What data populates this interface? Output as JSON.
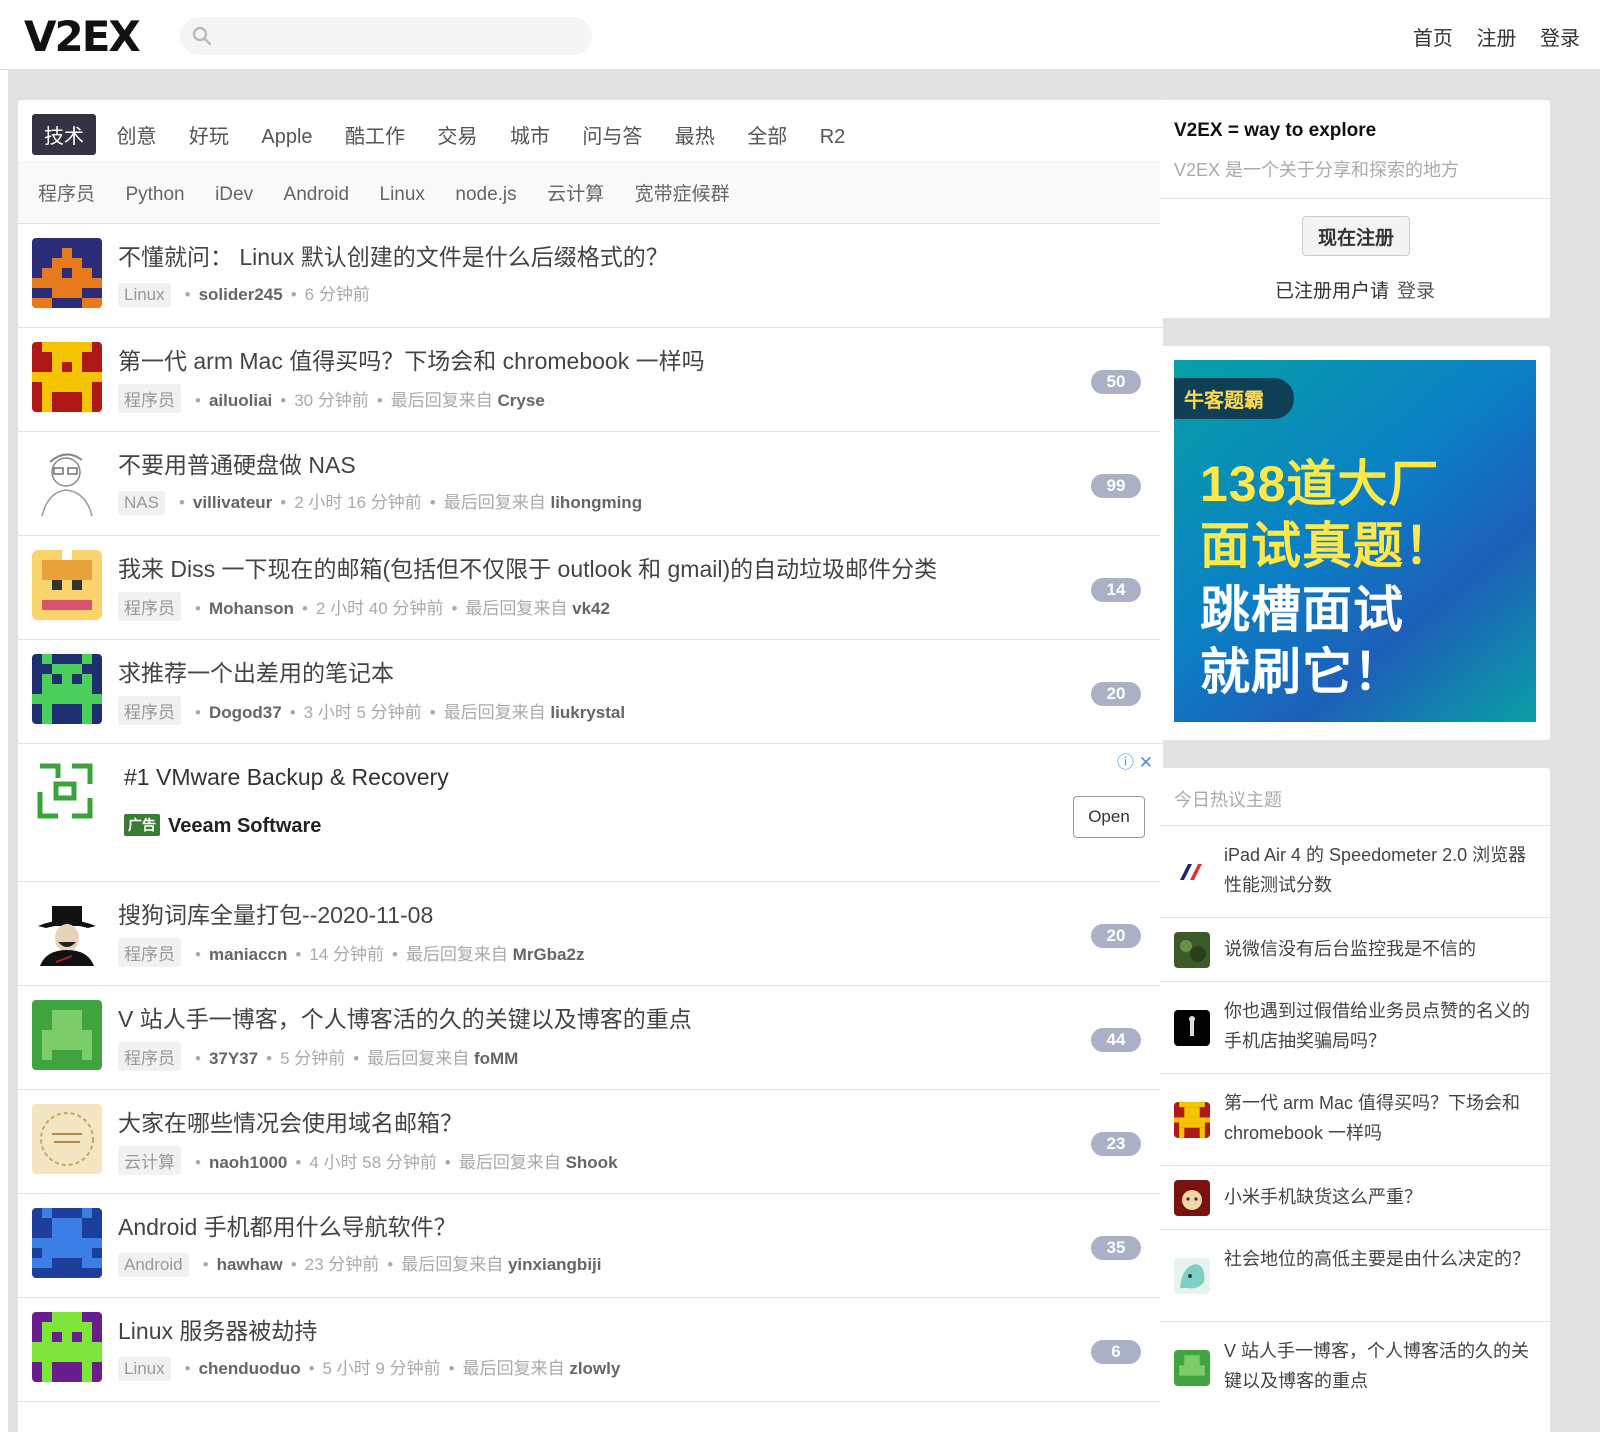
{
  "header": {
    "logo": "V2EX",
    "search_placeholder": "",
    "nav": [
      "首页",
      "注册",
      "登录"
    ]
  },
  "tabs": [
    "技术",
    "创意",
    "好玩",
    "Apple",
    "酷工作",
    "交易",
    "城市",
    "问与答",
    "最热",
    "全部",
    "R2"
  ],
  "active_tab": "技术",
  "subtabs": [
    "程序员",
    "Python",
    "iDev",
    "Android",
    "Linux",
    "node.js",
    "云计算",
    "宽带症候群"
  ],
  "topics": [
    {
      "title": "不懂就问： Linux 默认创建的文件是什么后缀格式的？",
      "node": "Linux",
      "user": "solider245",
      "time": "6 分钟前",
      "reply_prefix": "",
      "last_reply": "",
      "count": ""
    },
    {
      "title": "第一代 arm Mac 值得买吗？下场会和 chromebook 一样吗",
      "node": "程序员",
      "user": "ailuoliai",
      "time": "30 分钟前",
      "reply_prefix": "最后回复来自",
      "last_reply": "Cryse",
      "count": "50"
    },
    {
      "title": "不要用普通硬盘做 NAS",
      "node": "NAS",
      "user": "villivateur",
      "time": "2 小时 16 分钟前",
      "reply_prefix": "最后回复来自",
      "last_reply": "lihongming",
      "count": "99"
    },
    {
      "title": "我来 Diss 一下现在的邮箱(包括但不仅限于 outlook 和 gmail)的自动垃圾邮件分类",
      "node": "程序员",
      "user": "Mohanson",
      "time": "2 小时 40 分钟前",
      "reply_prefix": "最后回复来自",
      "last_reply": "vk42",
      "count": "14"
    },
    {
      "title": "求推荐一个出差用的笔记本",
      "node": "程序员",
      "user": "Dogod37",
      "time": "3 小时 5 分钟前",
      "reply_prefix": "最后回复来自",
      "last_reply": "liukrystal",
      "count": "20"
    }
  ],
  "ad": {
    "title": "#1 VMware Backup & Recovery",
    "tag": "广告",
    "sponsor": "Veeam Software",
    "button": "Open",
    "info": "ⓘ ✕"
  },
  "topics2": [
    {
      "title": "搜狗词库全量打包--2020-11-08",
      "node": "程序员",
      "user": "maniaccn",
      "time": "14 分钟前",
      "reply_prefix": "最后回复来自",
      "last_reply": "MrGba2z",
      "count": "20"
    },
    {
      "title": "V 站人手一博客，个人博客活的久的关键以及博客的重点",
      "node": "程序员",
      "user": "37Y37",
      "time": "5 分钟前",
      "reply_prefix": "最后回复来自",
      "last_reply": "foMM",
      "count": "44"
    },
    {
      "title": "大家在哪些情况会使用域名邮箱？",
      "node": "云计算",
      "user": "naoh1000",
      "time": "4 小时 58 分钟前",
      "reply_prefix": "最后回复来自",
      "last_reply": "Shook",
      "count": "23"
    },
    {
      "title": "Android 手机都用什么导航软件？",
      "node": "Android",
      "user": "hawhaw",
      "time": "23 分钟前",
      "reply_prefix": "最后回复来自",
      "last_reply": "yinxiangbiji",
      "count": "35"
    },
    {
      "title": "Linux 服务器被劫持",
      "node": "Linux",
      "user": "chenduoduo",
      "time": "5 小时 9 分钟前",
      "reply_prefix": "最后回复来自",
      "last_reply": "zlowly",
      "count": "6"
    }
  ],
  "sidebar": {
    "intro_title": "V2EX = way to explore",
    "intro_desc": "V2EX 是一个关于分享和探索的地方",
    "register_button": "现在注册",
    "login_prompt": "已注册用户请",
    "login_link": "登录",
    "ad": {
      "brand": "牛客题霸",
      "line1": "138道大厂",
      "line2": "面试真题！",
      "line3": "跳槽面试",
      "line4": "就刷它！"
    },
    "hot_title": "今日热议主题",
    "hot": [
      "iPad Air 4 的 Speedometer 2.0 浏览器性能测试分数",
      "说微信没有后台监控我是不信的",
      "你也遇到过假借给业务员点赞的名义的手机店抽奖骗局吗？",
      "第一代 arm Mac 值得买吗？下场会和 chromebook 一样吗",
      "小米手机缺货这么严重？",
      "社会地位的高低主要是由什么决定的？",
      "V 站人手一博客，个人博客活的久的关键以及博客的重点"
    ]
  },
  "colors": {
    "accent": "#334455",
    "count_badge": "#aab0c6",
    "background": "#e2e2e2"
  }
}
